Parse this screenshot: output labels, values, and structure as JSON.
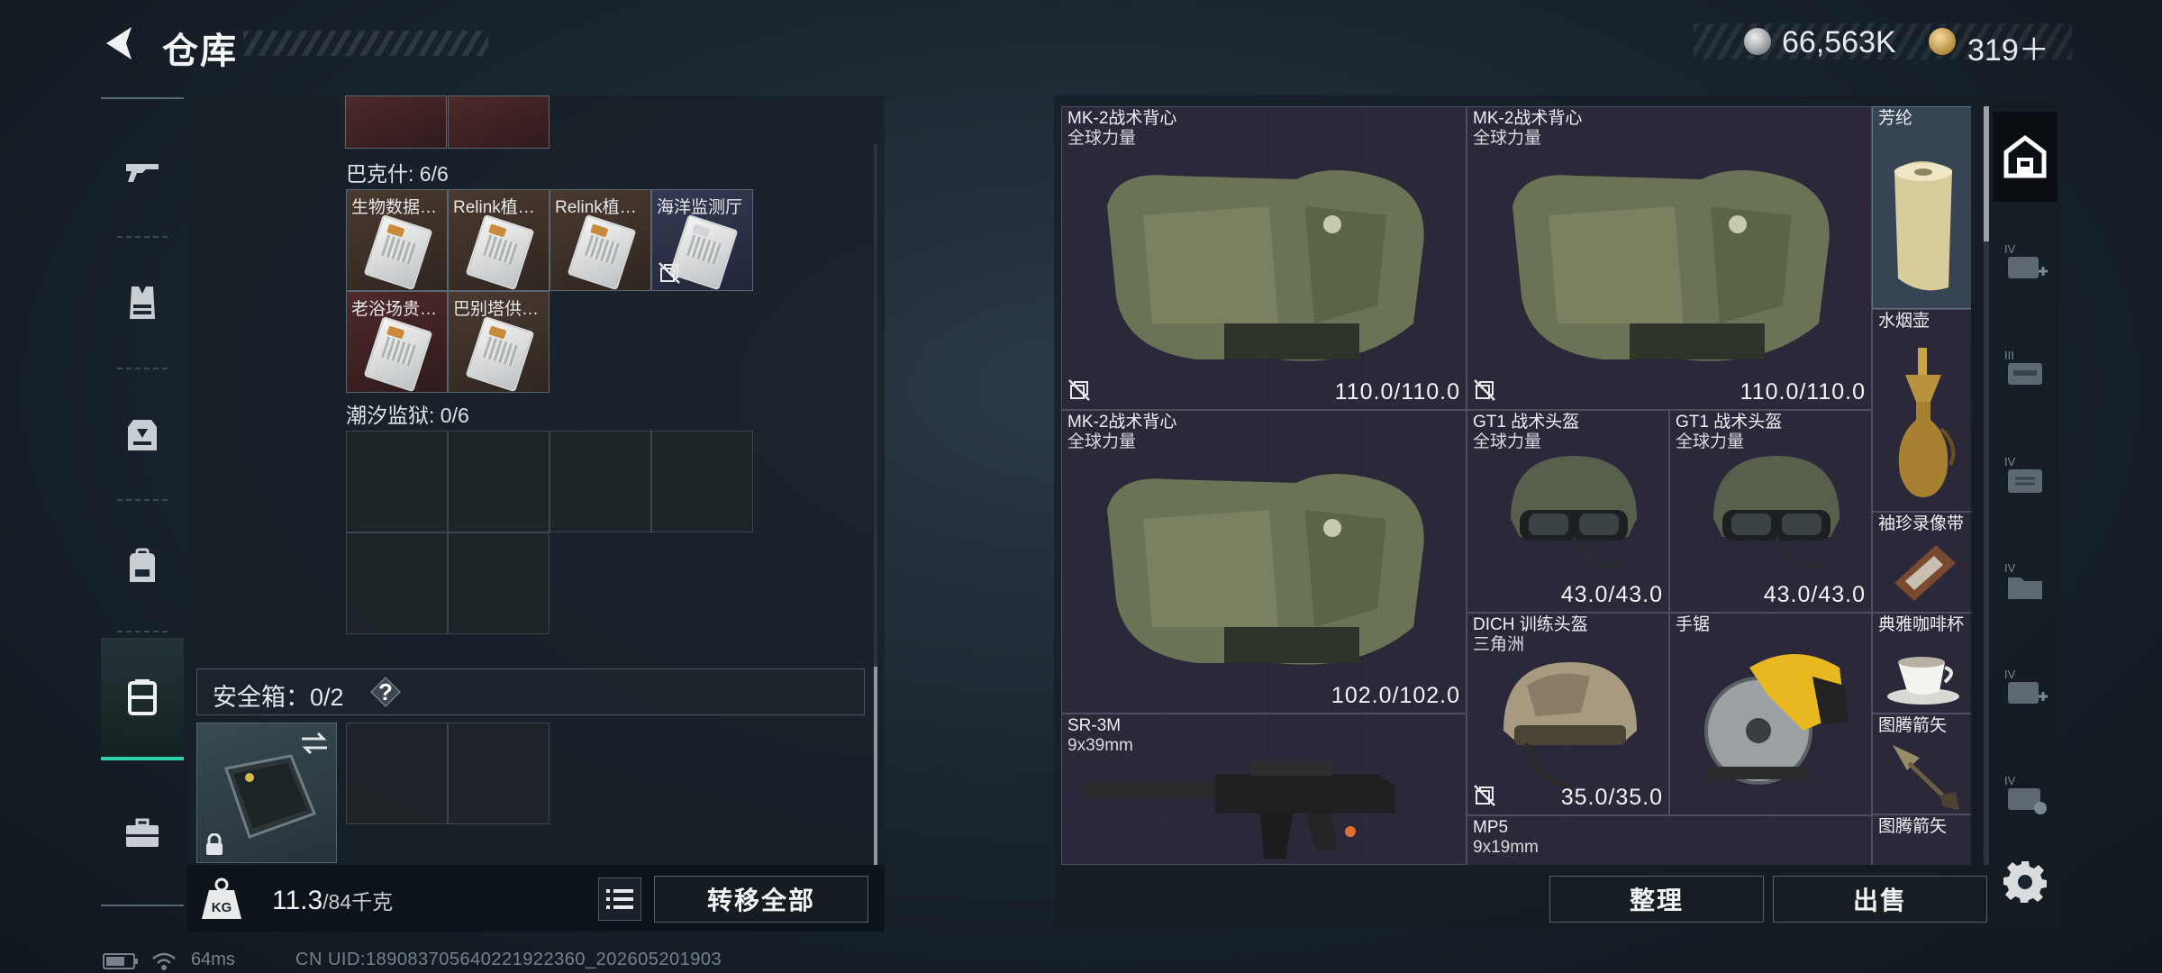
{
  "header": {
    "title": "仓库",
    "currency_silver": "66,563K",
    "currency_gold": "319＋"
  },
  "left_nav": {
    "items": [
      "rifle-icon",
      "vest-icon",
      "armor-icon",
      "backpack-icon",
      "storage-box-icon",
      "briefcase-icon"
    ],
    "active": "storage-box-icon"
  },
  "storage": {
    "section_prev_partial": "",
    "bakshi": {
      "label": "巴克什: 6/6",
      "items": [
        {
          "name": "生物数据…"
        },
        {
          "name": "Relink植…"
        },
        {
          "name": "Relink植…"
        },
        {
          "name": "海洋监测厅"
        },
        {
          "name": "老浴场贵…"
        },
        {
          "name": "巴别塔供…"
        }
      ]
    },
    "tidal_prison": {
      "label": "潮汐监狱: 0/6"
    },
    "safe_box": {
      "label": "安全箱：0/2",
      "help": "?"
    },
    "weight": {
      "current": "11.3",
      "max": "/84千克"
    },
    "transfer_all": "转移全部"
  },
  "inventory": {
    "items": [
      {
        "name": "MK-2战术背心",
        "sub": "全球力量",
        "durability": "110.0/110.0"
      },
      {
        "name": "MK-2战术背心",
        "sub": "全球力量",
        "durability": "110.0/110.0"
      },
      {
        "name": "芳纶",
        "sub": "",
        "durability": ""
      },
      {
        "name": "水烟壶",
        "sub": "",
        "durability": ""
      },
      {
        "name": "MK-2战术背心",
        "sub": "全球力量",
        "durability": "102.0/102.0"
      },
      {
        "name": "GT1 战术头盔",
        "sub": "全球力量",
        "durability": "43.0/43.0"
      },
      {
        "name": "GT1 战术头盔",
        "sub": "全球力量",
        "durability": "43.0/43.0"
      },
      {
        "name": "袖珍录像带",
        "sub": "",
        "durability": ""
      },
      {
        "name": "典雅咖啡杯",
        "sub": "",
        "durability": ""
      },
      {
        "name": "DICH 训练头盔",
        "sub": "三角洲",
        "durability": "35.0/35.0"
      },
      {
        "name": "手锯",
        "sub": "",
        "durability": ""
      },
      {
        "name": "图腾箭矢",
        "sub": "",
        "durability": ""
      },
      {
        "name": "SR-3M",
        "sub": "9x39mm",
        "durability": ""
      },
      {
        "name": "MP5",
        "sub": "9x19mm",
        "durability": ""
      },
      {
        "name": "图腾箭矢",
        "sub": "",
        "durability": ""
      }
    ],
    "sort_label": "整理",
    "sell_label": "出售"
  },
  "right_nav": {
    "active": "warehouse-icon",
    "tiers": [
      "IV",
      "III",
      "IV",
      "IV",
      "IV",
      "IV"
    ]
  },
  "status": {
    "ping": "64ms",
    "uid": "CN UID:189083705640221922360_202605201903"
  }
}
